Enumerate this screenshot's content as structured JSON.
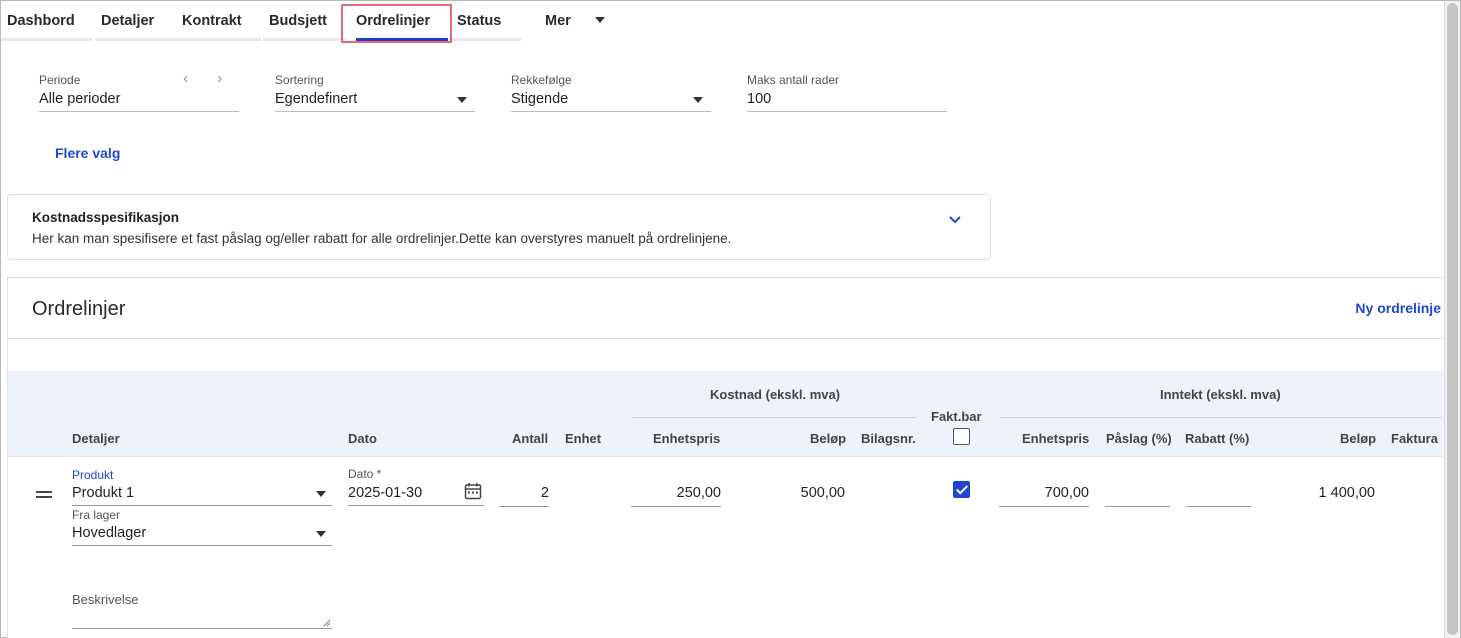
{
  "tabs": [
    {
      "label": "Dashbord"
    },
    {
      "label": "Detaljer"
    },
    {
      "label": "Kontrakt"
    },
    {
      "label": "Budsjett"
    },
    {
      "label": "Ordrelinjer"
    },
    {
      "label": "Status"
    },
    {
      "label": "Mer"
    }
  ],
  "filters": {
    "periode": {
      "label": "Periode",
      "value": "Alle perioder"
    },
    "sortering": {
      "label": "Sortering",
      "value": "Egendefinert"
    },
    "rekkefolge": {
      "label": "Rekkefølge",
      "value": "Stigende"
    },
    "maks": {
      "label": "Maks antall rader",
      "value": "100"
    },
    "more_options": "Flere valg"
  },
  "cost_spec": {
    "title": "Kostnadsspesifikasjon",
    "description": "Her kan man spesifisere et fast påslag og/eller rabatt for alle ordrelinjer.Dette kan overstyres manuelt på ordrelinjene."
  },
  "orderlines": {
    "title": "Ordrelinjer",
    "new_line": "Ny ordrelinje",
    "group_cost": "Kostnad (ekskl. mva)",
    "group_income": "Inntekt (ekskl. mva)",
    "headers": {
      "detaljer": "Detaljer",
      "dato": "Dato",
      "antall": "Antall",
      "enhet": "Enhet",
      "enhetspris_cost": "Enhetspris",
      "belop_cost": "Beløp",
      "bilagsnr": "Bilagsnr.",
      "faktbar": "Fakt.bar",
      "enhetspris_income": "Enhetspris",
      "paslag": "Påslag (%)",
      "rabatt": "Rabatt (%)",
      "belop_income": "Beløp",
      "faktura": "Faktura"
    },
    "row": {
      "produkt_label": "Produkt",
      "produkt_value": "Produkt 1",
      "lager_label": "Fra lager",
      "lager_value": "Hovedlager",
      "dato_label": "Dato *",
      "dato_value": "2025-01-30",
      "antall": "2",
      "enhetspris_cost": "250,00",
      "belop_cost": "500,00",
      "faktbar_checked": true,
      "enhetspris_income": "700,00",
      "belop_income": "1 400,00",
      "beskrivelse_label": "Beskrivelse"
    }
  },
  "colors": {
    "accent": "#1f46d2",
    "highlight": "#e06a78",
    "header_bg": "#eef2fb"
  }
}
